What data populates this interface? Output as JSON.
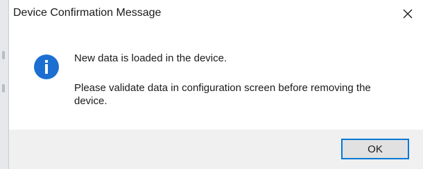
{
  "window": {
    "title": "Device Confirmation Message",
    "close_icon": "close-icon"
  },
  "message": {
    "icon": "info-icon",
    "line1": "New data is loaded in the device.",
    "line2": "Please validate data in configuration screen before removing the device."
  },
  "buttons": {
    "ok_label": "OK"
  },
  "colors": {
    "info_blue": "#1c6fd1",
    "focus_border": "#0078d7",
    "footer_bg": "#f0f0f0",
    "button_bg": "#e1e1e1"
  }
}
